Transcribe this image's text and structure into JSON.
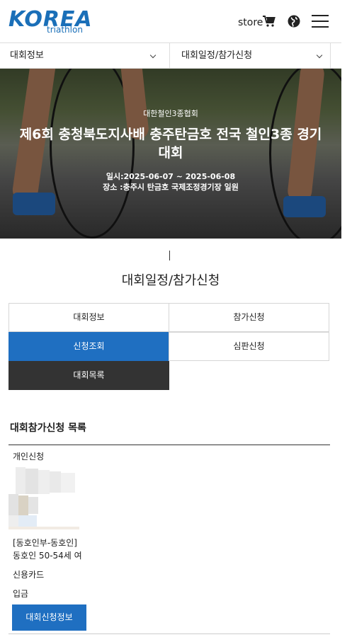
{
  "header": {
    "logo_text": "KOREA",
    "logo_sub": "triathlon",
    "store_label": "store"
  },
  "nav": {
    "left": "대회정보",
    "right": "대회일정/참가신청"
  },
  "hero": {
    "org": "대한철인3종협회",
    "title": "제6회 충청북도지사배 충주탄금호 전국 철인3종 경기대회",
    "date": "일시:2025-06-07 ~ 2025-06-08",
    "place": "장소 :충주시 탄금호 국제조정경기장 일원"
  },
  "section": {
    "title": "대회일정/참가신청"
  },
  "menu": {
    "items": [
      {
        "label": "대회정보"
      },
      {
        "label": "참가신청"
      },
      {
        "label": "신청조회"
      },
      {
        "label": "심판신청"
      },
      {
        "label": "대회목록"
      }
    ]
  },
  "list": {
    "title": "대회참가신청 목록",
    "type": "개인신청",
    "division": "[동호인부-동호인]",
    "group": "동호인 50-54세 여",
    "payment": "신용카드",
    "status": "입금",
    "detail_button": "대회신청정보"
  },
  "colors": {
    "brand_blue": "#1f6fc1",
    "dark": "#333333"
  }
}
